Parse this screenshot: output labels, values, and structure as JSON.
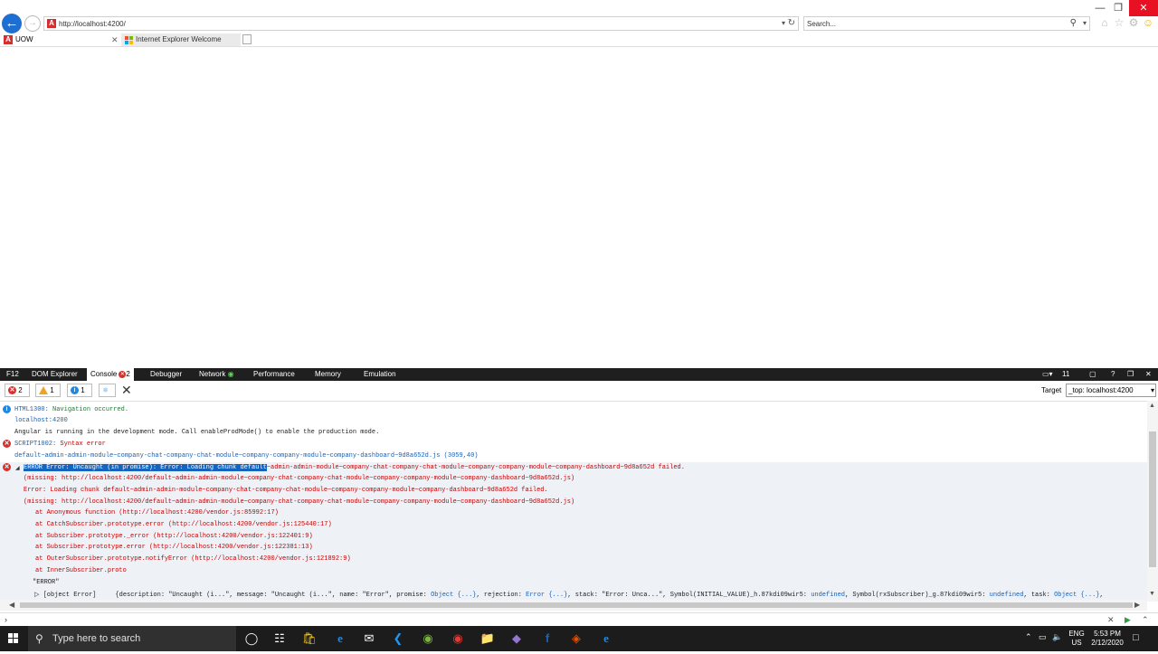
{
  "browser": {
    "address": "http://localhost:4200/",
    "search_placeholder": "Search...",
    "tabs": [
      {
        "label": "UOW",
        "active": true
      },
      {
        "label": "Internet Explorer Welcome",
        "active": false
      }
    ]
  },
  "devtools": {
    "tabs": {
      "f12": "F12",
      "dom": "DOM Explorer",
      "console": "Console",
      "console_errors": "2",
      "debugger": "Debugger",
      "network": "Network",
      "performance": "Performance",
      "memory": "Memory",
      "emulation": "Emulation"
    },
    "doc_mode": "11",
    "filters": {
      "errors": "2",
      "warnings": "1",
      "info": "1"
    },
    "target_label": "Target",
    "target_value": "_top: localhost:4200",
    "console": {
      "l1_code": "HTML1300:",
      "l1_text": " Navigation occurred.",
      "l2": "localhost:4200",
      "l3": "Angular is running in the development mode. Call enableProdMode() to enable the production mode.",
      "l4_code": "SCRIPT1002:",
      "l4_text": " Syntax error",
      "l5": "default~admin-admin-module~company-chat-company-chat-module~company-company-module~company-dashboard~9d8a652d.js (3059,40)",
      "e_hl": "ERROR Error: Uncaught (in promise): Error: Loading chunk default",
      "e_rest": "~admin-admin-module~company-chat-company-chat-module~company-company-module~company-dashboard~9d8a652d failed.",
      "e2": "(missing: http://localhost:4200/default~admin-admin-module~company-chat-company-chat-module~company-company-module~company-dashboard~9d8a652d.js)",
      "e3": "Error: Loading chunk default~admin-admin-module~company-chat-company-chat-module~company-company-module~company-dashboard~9d8a652d failed.",
      "e4": "(missing: http://localhost:4200/default~admin-admin-module~company-chat-company-chat-module~company-company-module~company-dashboard~9d8a652d.js)",
      "s1": "at Anonymous function (http://localhost:4200/vendor.js:85992:17)",
      "s2": "at CatchSubscriber.prototype.error (http://localhost:4200/vendor.js:125440:17)",
      "s3": "at Subscriber.prototype._error (http://localhost:4200/vendor.js:122401:9)",
      "s4": "at Subscriber.prototype.error (http://localhost:4200/vendor.js:122381:13)",
      "s5": "at OuterSubscriber.prototype.notifyError (http://localhost:4200/vendor.js:121892:9)",
      "s6": "at InnerSubscriber.proto",
      "err_str": "\"ERROR\"",
      "obj_label": "[object Error]",
      "obj_p1": "{description: \"Uncaught (i...\", message: \"Uncaught (i...\", name: \"Error\", promise: ",
      "obj_o1": "Object {...}",
      "obj_p2": ", rejection: ",
      "obj_o2": "Error {...}",
      "obj_p3": ", stack: \"Error: Unca...\", Symbol(INITIAL_VALUE)_h.87kdi09wir5: ",
      "obj_u1": "undefined",
      "obj_p4": ", Symbol(rxSubscriber)_g.87kdi09wir5: ",
      "obj_u2": "undefined",
      "obj_p5": ", task: ",
      "obj_o3": "Object {...}",
      "obj_p6": ","
    }
  },
  "taskbar": {
    "search_placeholder": "Type here to search",
    "lang": "ENG",
    "region": "US",
    "time": "5:53 PM",
    "date": "2/12/2020"
  },
  "colors": {
    "ie_blue": "#1e6fd1",
    "error_red": "#d9302b",
    "close_red": "#e81123"
  }
}
